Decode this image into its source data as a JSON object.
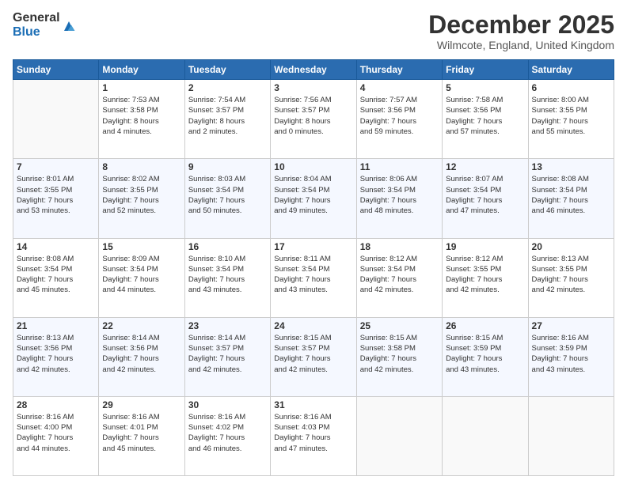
{
  "logo": {
    "general": "General",
    "blue": "Blue"
  },
  "header": {
    "month": "December 2025",
    "location": "Wilmcote, England, United Kingdom"
  },
  "days_of_week": [
    "Sunday",
    "Monday",
    "Tuesday",
    "Wednesday",
    "Thursday",
    "Friday",
    "Saturday"
  ],
  "weeks": [
    [
      {
        "day": "",
        "info": ""
      },
      {
        "day": "1",
        "info": "Sunrise: 7:53 AM\nSunset: 3:58 PM\nDaylight: 8 hours\nand 4 minutes."
      },
      {
        "day": "2",
        "info": "Sunrise: 7:54 AM\nSunset: 3:57 PM\nDaylight: 8 hours\nand 2 minutes."
      },
      {
        "day": "3",
        "info": "Sunrise: 7:56 AM\nSunset: 3:57 PM\nDaylight: 8 hours\nand 0 minutes."
      },
      {
        "day": "4",
        "info": "Sunrise: 7:57 AM\nSunset: 3:56 PM\nDaylight: 7 hours\nand 59 minutes."
      },
      {
        "day": "5",
        "info": "Sunrise: 7:58 AM\nSunset: 3:56 PM\nDaylight: 7 hours\nand 57 minutes."
      },
      {
        "day": "6",
        "info": "Sunrise: 8:00 AM\nSunset: 3:55 PM\nDaylight: 7 hours\nand 55 minutes."
      }
    ],
    [
      {
        "day": "7",
        "info": "Sunrise: 8:01 AM\nSunset: 3:55 PM\nDaylight: 7 hours\nand 53 minutes."
      },
      {
        "day": "8",
        "info": "Sunrise: 8:02 AM\nSunset: 3:55 PM\nDaylight: 7 hours\nand 52 minutes."
      },
      {
        "day": "9",
        "info": "Sunrise: 8:03 AM\nSunset: 3:54 PM\nDaylight: 7 hours\nand 50 minutes."
      },
      {
        "day": "10",
        "info": "Sunrise: 8:04 AM\nSunset: 3:54 PM\nDaylight: 7 hours\nand 49 minutes."
      },
      {
        "day": "11",
        "info": "Sunrise: 8:06 AM\nSunset: 3:54 PM\nDaylight: 7 hours\nand 48 minutes."
      },
      {
        "day": "12",
        "info": "Sunrise: 8:07 AM\nSunset: 3:54 PM\nDaylight: 7 hours\nand 47 minutes."
      },
      {
        "day": "13",
        "info": "Sunrise: 8:08 AM\nSunset: 3:54 PM\nDaylight: 7 hours\nand 46 minutes."
      }
    ],
    [
      {
        "day": "14",
        "info": "Sunrise: 8:08 AM\nSunset: 3:54 PM\nDaylight: 7 hours\nand 45 minutes."
      },
      {
        "day": "15",
        "info": "Sunrise: 8:09 AM\nSunset: 3:54 PM\nDaylight: 7 hours\nand 44 minutes."
      },
      {
        "day": "16",
        "info": "Sunrise: 8:10 AM\nSunset: 3:54 PM\nDaylight: 7 hours\nand 43 minutes."
      },
      {
        "day": "17",
        "info": "Sunrise: 8:11 AM\nSunset: 3:54 PM\nDaylight: 7 hours\nand 43 minutes."
      },
      {
        "day": "18",
        "info": "Sunrise: 8:12 AM\nSunset: 3:54 PM\nDaylight: 7 hours\nand 42 minutes."
      },
      {
        "day": "19",
        "info": "Sunrise: 8:12 AM\nSunset: 3:55 PM\nDaylight: 7 hours\nand 42 minutes."
      },
      {
        "day": "20",
        "info": "Sunrise: 8:13 AM\nSunset: 3:55 PM\nDaylight: 7 hours\nand 42 minutes."
      }
    ],
    [
      {
        "day": "21",
        "info": "Sunrise: 8:13 AM\nSunset: 3:56 PM\nDaylight: 7 hours\nand 42 minutes."
      },
      {
        "day": "22",
        "info": "Sunrise: 8:14 AM\nSunset: 3:56 PM\nDaylight: 7 hours\nand 42 minutes."
      },
      {
        "day": "23",
        "info": "Sunrise: 8:14 AM\nSunset: 3:57 PM\nDaylight: 7 hours\nand 42 minutes."
      },
      {
        "day": "24",
        "info": "Sunrise: 8:15 AM\nSunset: 3:57 PM\nDaylight: 7 hours\nand 42 minutes."
      },
      {
        "day": "25",
        "info": "Sunrise: 8:15 AM\nSunset: 3:58 PM\nDaylight: 7 hours\nand 42 minutes."
      },
      {
        "day": "26",
        "info": "Sunrise: 8:15 AM\nSunset: 3:59 PM\nDaylight: 7 hours\nand 43 minutes."
      },
      {
        "day": "27",
        "info": "Sunrise: 8:16 AM\nSunset: 3:59 PM\nDaylight: 7 hours\nand 43 minutes."
      }
    ],
    [
      {
        "day": "28",
        "info": "Sunrise: 8:16 AM\nSunset: 4:00 PM\nDaylight: 7 hours\nand 44 minutes."
      },
      {
        "day": "29",
        "info": "Sunrise: 8:16 AM\nSunset: 4:01 PM\nDaylight: 7 hours\nand 45 minutes."
      },
      {
        "day": "30",
        "info": "Sunrise: 8:16 AM\nSunset: 4:02 PM\nDaylight: 7 hours\nand 46 minutes."
      },
      {
        "day": "31",
        "info": "Sunrise: 8:16 AM\nSunset: 4:03 PM\nDaylight: 7 hours\nand 47 minutes."
      },
      {
        "day": "",
        "info": ""
      },
      {
        "day": "",
        "info": ""
      },
      {
        "day": "",
        "info": ""
      }
    ]
  ]
}
